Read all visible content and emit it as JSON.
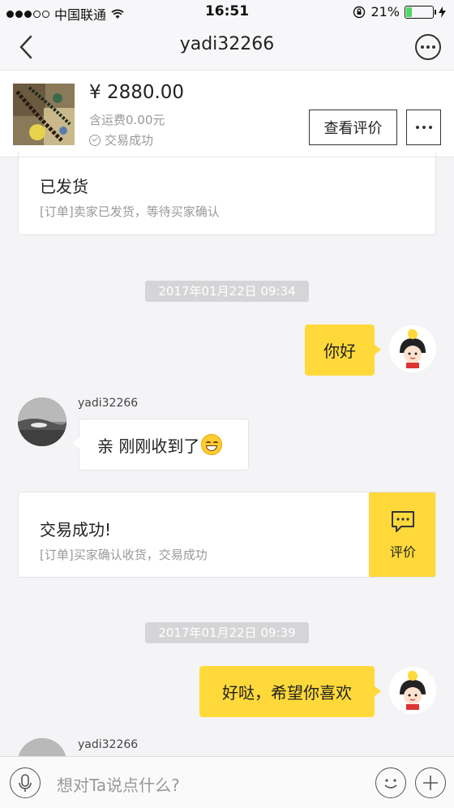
{
  "status_bar": {
    "carrier": "中国联通",
    "time": "16:51",
    "battery_percent": "21%",
    "battery_level": 0.21
  },
  "nav": {
    "title": "yadi32266",
    "back_icon": "chevron-left-icon",
    "more_icon": "more-circle-icon"
  },
  "product": {
    "price": "¥ 2880.00",
    "shipping": "含运费0.00元",
    "status": "交易成功",
    "review_button": "查看评价"
  },
  "cards": {
    "shipped": {
      "title": "已发货",
      "desc": "[订单]卖家已发货，等待买家确认"
    },
    "success": {
      "title": "交易成功!",
      "desc": "[订单]买家确认收货，交易成功",
      "action_label": "评价"
    }
  },
  "messages": {
    "timestamp1": "2017年01月22日  09:34",
    "msg1": "你好",
    "sender2": "yadi32266",
    "msg2": "亲 刚刚收到了",
    "timestamp2": "2017年01月22日  09:39",
    "msg3": "好哒，希望你喜欢",
    "sender4": "yadi32266"
  },
  "input": {
    "placeholder": "想对Ta说点什么?"
  },
  "colors": {
    "accent": "#ffd93a",
    "background": "#f4f4f7",
    "battery": "#4cd964"
  }
}
